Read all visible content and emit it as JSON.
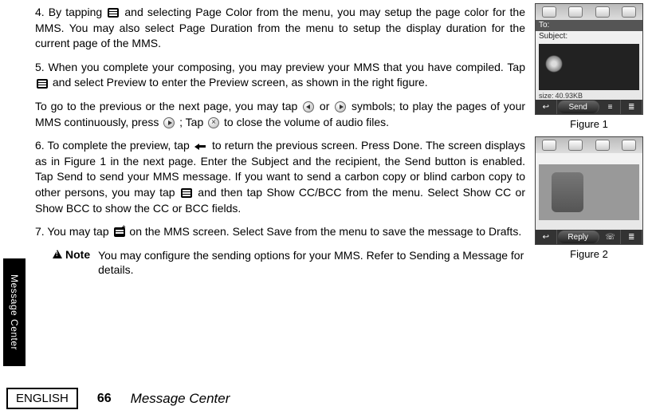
{
  "sidebar": {
    "label": "Message Center"
  },
  "body": {
    "p4": "4. By tapping ",
    "p4b": " and selecting Page Color from the menu, you may setup the page color for the MMS. You may also select Page Duration from the menu to setup the display duration for the current page of the MMS.",
    "p5": "5. When you complete your composing, you may preview your MMS that you have compiled. Tap ",
    "p5b": " and select Preview to enter the Preview screen, as shown in the right figure.",
    "nav1": "To go to the previous or the next page, you may tap ",
    "nav2": " or ",
    "nav3": " symbols; to play the pages of your MMS continuously, press ",
    "nav4": " ; Tap ",
    "nav5": " to close the volume of audio files.",
    "p6": "6. To complete the preview, tap ",
    "p6b": " to return the previous screen. Press Done. The screen displays as in Figure 1 in the next page. Enter the Subject and the recipient, the Send button is enabled. Tap Send to send your MMS message. If you want to send a carbon copy or blind carbon copy to other persons, you may tap ",
    "p6c": " and then tap Show CC/BCC from the menu. Select Show CC or Show BCC to show the CC or BCC fields.",
    "p7": "7. You may tap ",
    "p7b": " on the MMS screen. Select Save from the menu to save the message to Drafts.",
    "noteLabel": "Note",
    "noteText": "You may configure the sending options for your MMS. Refer to Sending a Message for details."
  },
  "fig1": {
    "caption": "Figure 1",
    "to": "To:",
    "subject": "Subject:",
    "sizeLabel": "size:",
    "sizeValue": "40.93KB",
    "send": "Send"
  },
  "fig2": {
    "caption": "Figure 2",
    "reply": "Reply"
  },
  "footer": {
    "lang": "ENGLISH",
    "pageNum": "66",
    "section": "Message Center"
  }
}
